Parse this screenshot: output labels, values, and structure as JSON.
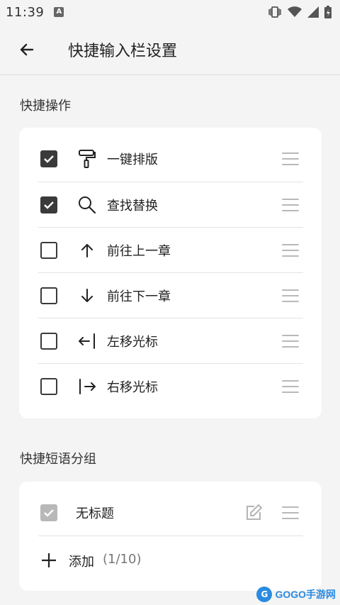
{
  "status_bar": {
    "time": "11:39",
    "notification_badge": "A"
  },
  "app_bar": {
    "title": "快捷输入栏设置"
  },
  "quick_actions": {
    "section_title": "快捷操作",
    "items": [
      {
        "label": "一键排版",
        "checked": true,
        "icon": "paint-roller-icon"
      },
      {
        "label": "查找替换",
        "checked": true,
        "icon": "search-icon"
      },
      {
        "label": "前往上一章",
        "checked": false,
        "icon": "arrow-up-icon"
      },
      {
        "label": "前往下一章",
        "checked": false,
        "icon": "arrow-down-icon"
      },
      {
        "label": "左移光标",
        "checked": false,
        "icon": "cursor-left-icon"
      },
      {
        "label": "右移光标",
        "checked": false,
        "icon": "cursor-right-icon"
      }
    ]
  },
  "phrase_groups": {
    "section_title": "快捷短语分组",
    "items": [
      {
        "label": "无标题",
        "checked": true,
        "disabled": true
      }
    ],
    "add_label": "添加",
    "add_count": "(1/10)"
  },
  "watermark": {
    "text": "GOGO手游网"
  },
  "colors": {
    "background": "#f5f4f5",
    "card": "#ffffff",
    "checkbox": "#3a3a3a",
    "disabled": "#b8b8b8",
    "handle": "#b9b9b9"
  }
}
